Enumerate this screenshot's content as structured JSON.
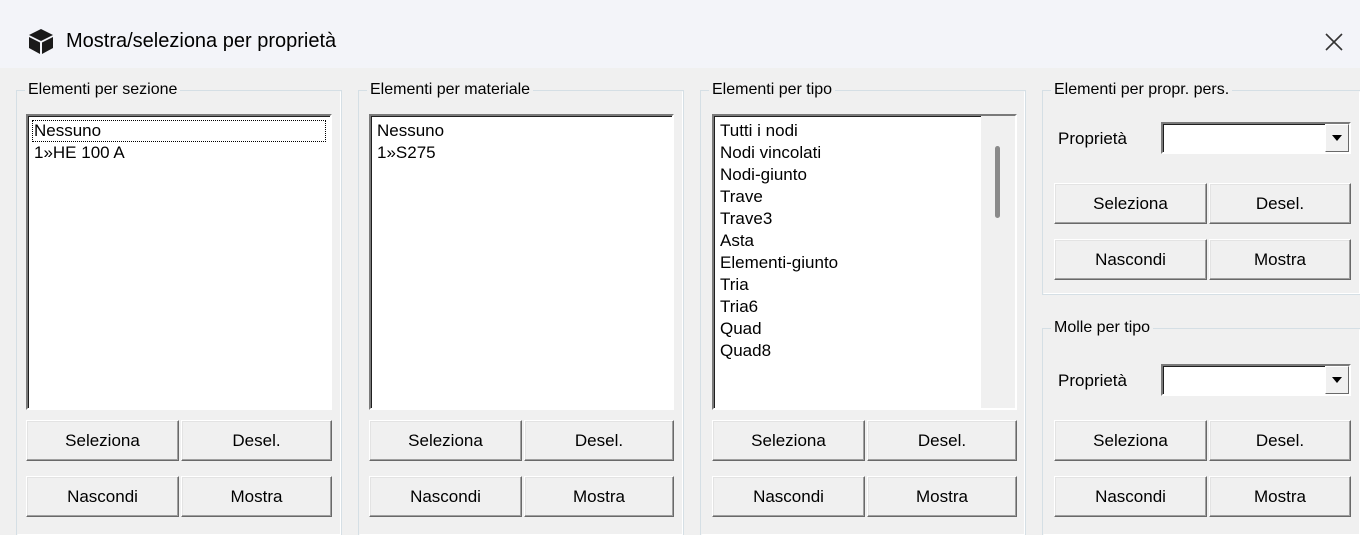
{
  "window": {
    "title": "Mostra/seleziona per proprietà",
    "icon": "cube-icon",
    "close_glyph": "✕"
  },
  "groups": {
    "sezione": {
      "label": "Elementi per sezione",
      "items": [
        "Nessuno",
        "1»HE 100 A"
      ],
      "focused_index": 0,
      "buttons": {
        "select": "Seleziona",
        "deselect": "Desel.",
        "hide": "Nascondi",
        "show": "Mostra"
      }
    },
    "materiale": {
      "label": "Elementi per materiale",
      "items": [
        "Nessuno",
        "1»S275"
      ],
      "buttons": {
        "select": "Seleziona",
        "deselect": "Desel.",
        "hide": "Nascondi",
        "show": "Mostra"
      }
    },
    "tipo": {
      "label": "Elementi per tipo",
      "items": [
        "Tutti i nodi",
        "Nodi vincolati",
        "Nodi-giunto",
        "Trave",
        "Trave3",
        "Asta",
        "Elementi-giunto",
        "Tria",
        "Tria6",
        "Quad",
        "Quad8"
      ],
      "buttons": {
        "select": "Seleziona",
        "deselect": "Desel.",
        "hide": "Nascondi",
        "show": "Mostra"
      }
    },
    "propr_pers": {
      "label": "Elementi per propr. pers.",
      "property_label": "Proprietà",
      "property_value": "",
      "buttons": {
        "select": "Seleziona",
        "deselect": "Desel.",
        "hide": "Nascondi",
        "show": "Mostra"
      }
    },
    "molle": {
      "label": "Molle per tipo",
      "property_label": "Proprietà",
      "property_value": "",
      "buttons": {
        "select": "Seleziona",
        "deselect": "Desel.",
        "hide": "Nascondi",
        "show": "Mostra"
      }
    }
  }
}
